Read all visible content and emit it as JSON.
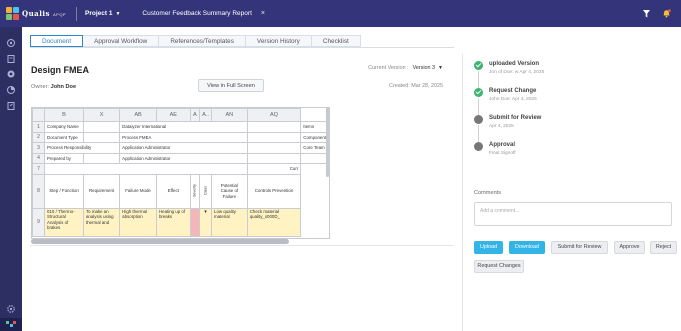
{
  "topbar": {
    "brand": "Qualis",
    "brand_sub": "APQP",
    "project": "Project 1",
    "project_caret": "▼",
    "open_tab_title": "Customer Feedback Summary Report",
    "open_tab_close": "×",
    "icons": [
      "filter-icon",
      "bell-icon"
    ]
  },
  "rail": {
    "icons": [
      "home-icon",
      "layers-icon",
      "target-icon",
      "chart-icon",
      "document-icon",
      "settings-icon"
    ]
  },
  "tabs": [
    "Document",
    "Approval Workflow",
    "References/Templates",
    "Version History",
    "Checklist"
  ],
  "active_tab": "Document",
  "document": {
    "title": "Design FMEA",
    "owner_label": "Owner:",
    "owner_name": "John Doe",
    "fullscreen_label": "View in Full Screen",
    "current_version_label": "Current Version :",
    "current_version": "Version 3",
    "version_caret": "▼",
    "created": "Created: Mar 28, 2025"
  },
  "sheet": {
    "col_headers": [
      "",
      "B",
      "X",
      "AB",
      "AE",
      "A",
      "A..",
      "AN",
      "AQ"
    ],
    "rows": [
      {
        "n": "1",
        "b": "Company Name",
        "ab": "Dataiyzer International",
        "aq": "Items"
      },
      {
        "n": "2",
        "b": "Document Type",
        "ab": "Process FMEA",
        "aq": "Component"
      },
      {
        "n": "3",
        "b": "Process Responsibility",
        "ab": "Application Administrator",
        "aq": "Core Team"
      },
      {
        "n": "4",
        "b": "Prepared by",
        "ab": "Application Administrator",
        "aq": ""
      }
    ],
    "row7": {
      "n": "7",
      "aq": "Curr"
    },
    "row8": {
      "n": "8",
      "b": "Step / Function",
      "x": "Requirement",
      "ab": "Failure Mode",
      "ae": "Effect",
      "a1": "Severity",
      "a2": "Class",
      "an": "Potential Cause of Failure",
      "aq": "Controls Prevention"
    },
    "row9": {
      "n": "9",
      "b": "010 / Thermo-Structural Analysis of brakes",
      "x": "To make an analysis using thermal and",
      "ab": "High thermal absorption",
      "ae": "Heating up of breaks",
      "a1": "",
      "a2": "▼",
      "an": "Low quality material",
      "aq": "Check material quality_x000D_"
    }
  },
  "workflow": {
    "steps": [
      {
        "title": "uploaded Version",
        "sub": "Jon of Doe: w Apr 4, 2025",
        "status": "done"
      },
      {
        "title": "Request Change",
        "sub": "John Doe: Apr 4, 2025",
        "status": "done"
      },
      {
        "title": "Submit for Review",
        "sub": "Apr 4, 2025",
        "status": "pending"
      },
      {
        "title": "Approval",
        "sub": "Final Signoff",
        "status": "pending"
      }
    ],
    "comments_label": "Comments",
    "comment_placeholder": "Add a comment...",
    "buttons": {
      "upload": "Upload",
      "download": "Download",
      "submit": "Submit for Review",
      "approve": "Approve",
      "reject": "Reject",
      "request_changes": "Request Changes"
    }
  },
  "colors": {
    "topbar": "#34347a",
    "rail": "#2d2f63",
    "accent_blue": "#33b4e6",
    "done_green": "#3cb371"
  }
}
